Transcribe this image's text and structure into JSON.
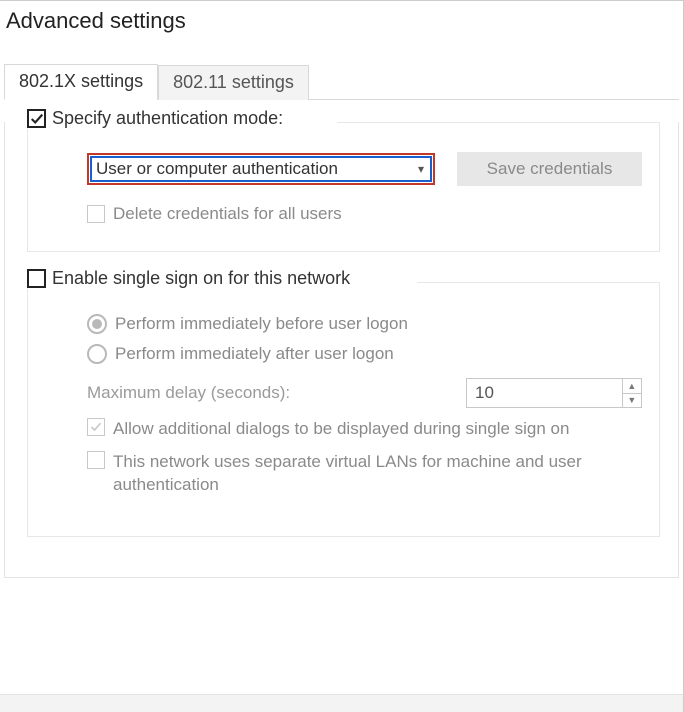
{
  "title": "Advanced settings",
  "tabs": {
    "t1": "802.1X settings",
    "t2": "802.11 settings"
  },
  "group1": {
    "legend": "Specify authentication mode:",
    "dropdown_value": "User or computer authentication",
    "save_btn": "Save credentials",
    "delete_creds": "Delete credentials for all users"
  },
  "group2": {
    "legend": "Enable single sign on for this network",
    "radio_before": "Perform immediately before user logon",
    "radio_after": "Perform immediately after user logon",
    "max_delay_label": "Maximum delay (seconds):",
    "max_delay_value": "10",
    "allow_dialogs": "Allow additional dialogs to be displayed during single sign on",
    "separate_vlans": "This network uses separate virtual LANs for machine and user authentication"
  }
}
